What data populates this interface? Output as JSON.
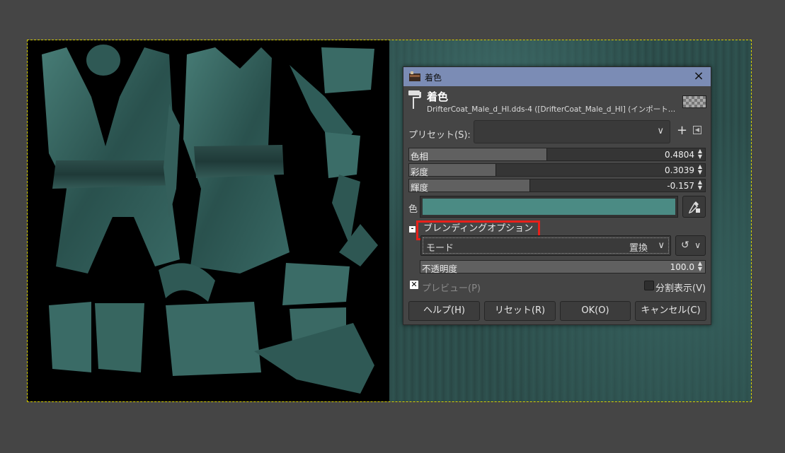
{
  "dialog": {
    "window_title": "着色",
    "header_title": "着色",
    "header_subtitle": "DrifterCoat_Male_d_HI.dds-4 ([DrifterCoat_Male_d_HI] (インポート…",
    "preset_label": "プリセット(S):",
    "preset_value": "",
    "sliders": [
      {
        "label": "色相",
        "value": "0.4804",
        "fraction": 0.465
      },
      {
        "label": "彩度",
        "value": "0.3039",
        "fraction": 0.293
      },
      {
        "label": "輝度",
        "value": "-0.157",
        "fraction": 0.407
      }
    ],
    "color_label": "色",
    "color_value": "#4b8b84",
    "blending_options_label": "ブレンディングオプション",
    "mode_label": "モード",
    "mode_value": "置換",
    "opacity_label": "不透明度",
    "opacity_value": "100.0",
    "preview_label": "プレビュー(P)",
    "preview_checked": true,
    "split_view_label": "分割表示(V)",
    "split_view_checked": false,
    "buttons": {
      "help": "ヘルプ(H)",
      "reset": "リセット(R)",
      "ok": "OK(O)",
      "cancel": "キャンセル(C)"
    }
  },
  "colors": {
    "title_bar": "#7b8cb5",
    "highlight_box": "#e8201a",
    "canvas_selection": "#d8d000"
  },
  "icons": {
    "close": "close-icon",
    "preset_add": "plus-icon",
    "preset_menu": "triangle-left-icon",
    "color_picker": "eyedropper-icon",
    "composite": "reset-composite-icon"
  }
}
